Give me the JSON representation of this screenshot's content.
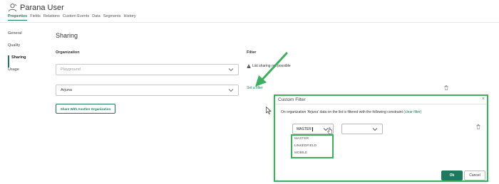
{
  "header": {
    "title": "Parana User",
    "tabs": [
      {
        "label": "Properties"
      },
      {
        "label": "Fields"
      },
      {
        "label": "Relations"
      },
      {
        "label": "Custom Events"
      },
      {
        "label": "Data"
      },
      {
        "label": "Segments"
      },
      {
        "label": "History"
      }
    ],
    "active_tab": "Properties"
  },
  "sidebar": {
    "items": [
      {
        "label": "General"
      },
      {
        "label": "Quality"
      },
      {
        "label": "Sharing"
      },
      {
        "label": "Usage"
      }
    ],
    "active_item": "Sharing"
  },
  "main": {
    "section_title": "Sharing",
    "organization_label": "Organization",
    "org_select_1_placeholder": "Playground",
    "org_select_2_value": "Arjuna",
    "share_button_label": "Share With Another Organization",
    "filter_label": "Filter",
    "filter_warning": "List sharing not possible",
    "set_filter_link": "Set a filter"
  },
  "dialog": {
    "title": "Custom Filter",
    "message_prefix": "On organization 'Arjuna' data on the list is filtered with the following constraint",
    "clear_filter_link": "(clear filter)",
    "field_select_value": "MASTER",
    "field_options": [
      {
        "label": "MASTER"
      },
      {
        "label": "LINKEDFIELD"
      },
      {
        "label": "MOBILE"
      }
    ],
    "ok_label": "Ok",
    "cancel_label": "Cancel"
  },
  "colors": {
    "accent": "#1e7a5c",
    "highlight": "#3cb05e"
  }
}
